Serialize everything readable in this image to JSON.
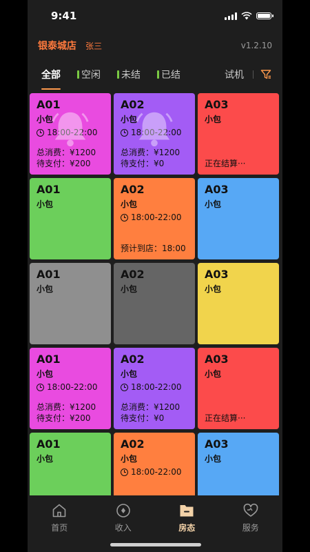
{
  "status_bar": {
    "time": "9:41"
  },
  "header": {
    "store_name": "银泰城店",
    "user_name": "张三",
    "version": "v1.2.10"
  },
  "tabs": {
    "items": [
      {
        "label": "全部",
        "active": true
      },
      {
        "label": "空闲",
        "marker_color": "#7ac943"
      },
      {
        "label": "未结",
        "marker_color": "#7ac943"
      },
      {
        "label": "已结",
        "marker_color": "#7ac943"
      }
    ],
    "trial_label": "试机",
    "filter_icon": "filter-icon"
  },
  "rooms": [
    {
      "code": "A01",
      "type": "小包",
      "color": "#e94be0",
      "time": "18:00-22:00",
      "line1": "总消费：¥1200",
      "line2": "待支付：¥200",
      "bell": true
    },
    {
      "code": "A02",
      "type": "小包",
      "color": "#a35cf5",
      "time": "18:00-22:00",
      "line1": "总消费：¥1200",
      "line2": "待支付：¥0",
      "bell": true
    },
    {
      "code": "A03",
      "type": "小包",
      "color": "#fc4b4b",
      "line2": "正在结算···"
    },
    {
      "code": "A01",
      "type": "小包",
      "color": "#6ccf5b"
    },
    {
      "code": "A02",
      "type": "小包",
      "color": "#ff7f3f",
      "time": "18:00-22:00",
      "line2": "预计到店：18:00"
    },
    {
      "code": "A03",
      "type": "小包",
      "color": "#57a8f5"
    },
    {
      "code": "A01",
      "type": "小包",
      "color": "#8f8f8f"
    },
    {
      "code": "A02",
      "type": "小包",
      "color": "#656565"
    },
    {
      "code": "A03",
      "type": "小包",
      "color": "#f1d44c"
    },
    {
      "code": "A01",
      "type": "小包",
      "color": "#e94be0",
      "time": "18:00-22:00",
      "line1": "总消费：¥1200",
      "line2": "待支付：¥200"
    },
    {
      "code": "A02",
      "type": "小包",
      "color": "#a35cf5",
      "time": "18:00-22:00",
      "line1": "总消费：¥1200",
      "line2": "待支付：¥0"
    },
    {
      "code": "A03",
      "type": "小包",
      "color": "#fc4b4b",
      "line2": "正在结算···"
    },
    {
      "code": "A01",
      "type": "小包",
      "color": "#6ccf5b"
    },
    {
      "code": "A02",
      "type": "小包",
      "color": "#ff7f3f",
      "time": "18:00-22:00"
    },
    {
      "code": "A03",
      "type": "小包",
      "color": "#57a8f5"
    }
  ],
  "tabbar": [
    {
      "label": "首页",
      "icon": "home-icon"
    },
    {
      "label": "收入",
      "icon": "income-icon"
    },
    {
      "label": "房态",
      "icon": "room-status-icon",
      "active": true
    },
    {
      "label": "服务",
      "icon": "service-icon"
    }
  ],
  "colors": {
    "accent": "#ff7a3d",
    "tab_underline": "#ff9a4d",
    "tabbar_active": "#f3d2a8"
  }
}
